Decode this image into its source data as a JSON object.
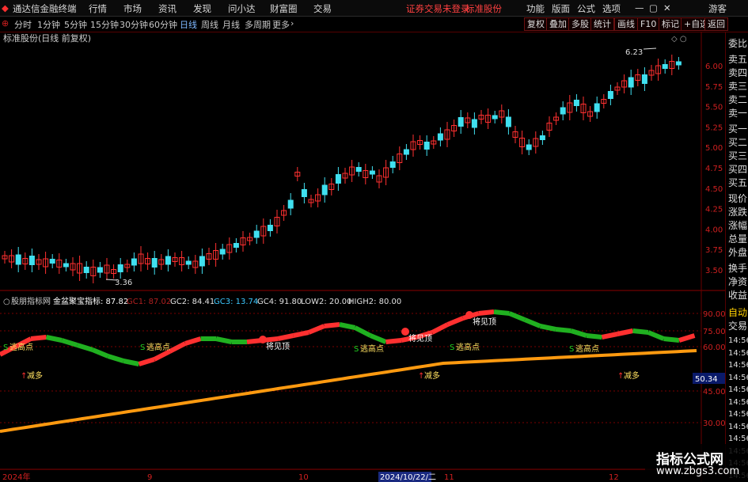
{
  "menubar": {
    "app_title": "通达信金融终端",
    "menus": [
      "行情",
      "市场",
      "资讯",
      "发现",
      "问小达",
      "财富圈",
      "交易"
    ],
    "status_text": "证券交易未登录",
    "stock_name": "标准股份",
    "right_menus": [
      "功能",
      "版面",
      "公式",
      "选项"
    ],
    "guest": "游客"
  },
  "toolbar": {
    "periods": [
      "分时",
      "1分钟",
      "5分钟",
      "15分钟",
      "30分钟",
      "60分钟",
      "日线",
      "周线",
      "月线",
      "多周期",
      "更多"
    ],
    "active_period": "日线",
    "buttons": [
      "复权",
      "叠加",
      "多股",
      "统计",
      "画线",
      "F10",
      "标记",
      "+自选",
      "返回"
    ]
  },
  "main_chart": {
    "title": "标准股份(日线 前复权)",
    "high_label": "6.23",
    "low_label": "3.36",
    "y_labels": [
      "6.00",
      "5.75",
      "5.50",
      "5.25",
      "5.00",
      "4.75",
      "4.50",
      "4.25",
      "4.00",
      "3.75",
      "3.50"
    ]
  },
  "indicator": {
    "source": "股朋指标网",
    "name": "金盆聚宝指标: 87.82",
    "values": [
      {
        "label": "GC1: 87.02",
        "color": "#b02020"
      },
      {
        "label": "GC2: 84.41",
        "color": "#e0e0e0"
      },
      {
        "label": "GC3: 13.74",
        "color": "#3cc8ff"
      },
      {
        "label": "GC4: 91.80",
        "color": "#e0e0e0"
      },
      {
        "label": "LOW2: 20.00",
        "color": "#e0e0e0"
      },
      {
        "label": "HIGH2: 80.00",
        "color": "#e0e0e0"
      }
    ],
    "y_labels": [
      "90.00",
      "75.00",
      "60.00",
      "45.00",
      "30.00"
    ],
    "current_value": "50.34",
    "signal_escape": "逃高点",
    "signal_top": "将见顶",
    "signal_long": "减多"
  },
  "date_axis": [
    "2024年",
    "9",
    "10",
    "2024/10/22/二",
    "11",
    "12"
  ],
  "side_panel": {
    "items": [
      "委比",
      "卖五",
      "卖四",
      "卖三",
      "卖二",
      "卖一",
      "买一",
      "买二",
      "买三",
      "买四",
      "买五",
      "现价",
      "涨跌",
      "涨幅",
      "总量",
      "外盘",
      "换手",
      "净资",
      "收益"
    ],
    "lower_items": [
      "自动",
      "交易"
    ],
    "times": [
      "14:56",
      "14:56",
      "14:56",
      "14:56",
      "14:56",
      "14:56",
      "14:56",
      "14:56",
      "14:56",
      "14:56",
      "14:56",
      "14:56"
    ]
  },
  "watermark": {
    "title": "指标公式网",
    "url": "www.zbgs3.com"
  },
  "colors": {
    "up": "#ff3030",
    "down": "#40e0f0",
    "green": "#20b020",
    "orange": "#ff9a10",
    "grid": "#7a0000",
    "axis_text": "#d02020"
  }
}
